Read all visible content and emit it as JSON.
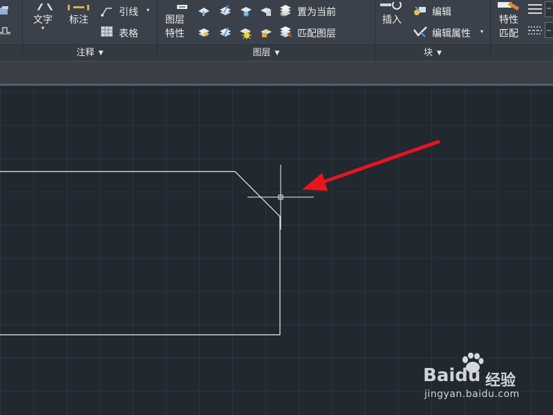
{
  "ribbon": {
    "annotation": {
      "text_label": "文字",
      "dimension_label": "标注",
      "leader_label": "引线",
      "table_label": "表格",
      "panel_title": "注释"
    },
    "layers": {
      "properties_label_1": "图层",
      "properties_label_2": "特性",
      "set_current_label": "置为当前",
      "match_layer_label": "匹配图层",
      "panel_title": "图层"
    },
    "block": {
      "insert_label": "插入",
      "edit_label": "编辑",
      "edit_attributes_label": "编辑属性",
      "panel_title": "块"
    },
    "properties": {
      "match_label_1": "特性",
      "match_label_2": "匹配"
    }
  },
  "colors": {
    "ribbon_bg": "#3b414a",
    "canvas_bg": "#212830",
    "arrow": "#e8141e",
    "drawing_line": "#f0f0f0"
  },
  "watermark": {
    "brand": "Baidu",
    "product": "经验",
    "url": "jingyan.baidu.com"
  }
}
